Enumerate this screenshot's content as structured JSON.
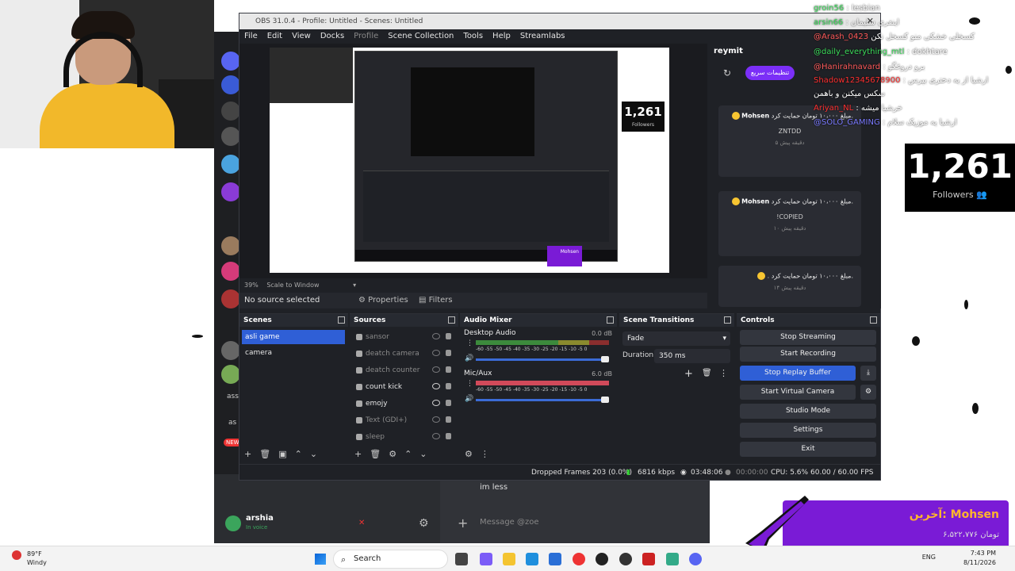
{
  "obs": {
    "title": "OBS 31.0.4 - Profile: Untitled - Scenes: Untitled",
    "menu": [
      "File",
      "Edit",
      "View",
      "Docks",
      "Profile",
      "Scene Collection",
      "Tools",
      "Help",
      "Streamlabs"
    ],
    "scale": {
      "percent": "39%",
      "mode": "Scale to Window"
    },
    "no_source": "No source selected",
    "properties": "Properties",
    "filters": "Filters",
    "scenes": {
      "title": "Scenes",
      "items": [
        "asli game",
        "camera"
      ],
      "selected": 0
    },
    "sources": {
      "title": "Sources",
      "items": [
        {
          "name": "sansor",
          "visible": false
        },
        {
          "name": "deatch camera",
          "visible": false
        },
        {
          "name": "deatch counter",
          "visible": false
        },
        {
          "name": "count kick",
          "visible": true
        },
        {
          "name": "emojy",
          "visible": true
        },
        {
          "name": "Text (GDI+)",
          "visible": false
        },
        {
          "name": "sleep",
          "visible": false
        }
      ]
    },
    "mixer": {
      "title": "Audio Mixer",
      "channels": [
        {
          "name": "Desktop Audio",
          "db": "0.0 dB"
        },
        {
          "name": "Mic/Aux",
          "db": "6.0 dB"
        }
      ],
      "ticks": "-60 -55 -50 -45 -40 -35 -30 -25 -20 -15 -10 -5 0"
    },
    "transitions": {
      "title": "Scene Transitions",
      "type": "Fade",
      "duration_label": "Duration",
      "duration": "350 ms"
    },
    "controls": {
      "title": "Controls",
      "buttons": [
        "Stop Streaming",
        "Start Recording",
        "Stop Replay Buffer",
        "Start Virtual Camera",
        "Studio Mode",
        "Settings",
        "Exit"
      ]
    },
    "status": {
      "dropped": "Dropped Frames 203 (0.0%)",
      "kbps": "6816 kbps",
      "live": "03:48:06",
      "rec": "00:00:00",
      "cpu": "CPU: 5.6%",
      "fps": "60.00 / 60.00 FPS"
    }
  },
  "dock": {
    "title": "reymit",
    "quick": "تنظیمات سریع",
    "messages": [
      {
        "user": "Mohsen",
        "text": "مبلغ ۱۰،۰۰۰ تومان حمایت کرد.",
        "sub": "ZNTDD",
        "time": "۵ دقیقه پیش"
      },
      {
        "user": "Mohsen",
        "text": "مبلغ ۱۰،۰۰۰ تومان حمایت کرد.",
        "sub": "!COPIED",
        "time": "۱۰ دقیقه پیش"
      },
      {
        "user": "",
        "text": ". مبلغ ۱۰،۰۰۰ تومان حمایت کرد.",
        "sub": "",
        "time": "۱۴ دقیقه پیش"
      }
    ]
  },
  "overlay_chat": [
    {
      "user": "groin56",
      "text": ": lesbian"
    },
    {
      "user": "arsin66",
      "text": ": اینفری سلیمان"
    },
    {
      "user": "@Arash_0423",
      "text": "کسخلی خشکی منو کسخل نکن"
    },
    {
      "user": "@daily_everything_mtl",
      "text": ": dokhtare"
    },
    {
      "user": "@Hanirahnavard",
      "text": ": برو دروغگو"
    },
    {
      "user": "Shadow12345678900",
      "text": ": ارشیا از یه دختری بپرس"
    },
    {
      "user": "",
      "text": "سکس میکنن و باهمن"
    },
    {
      "user": "Ariyan_NL",
      "text": ": خرشیا میشه"
    },
    {
      "user": "@SOLO_GAMING",
      "text": ": ارشیا یه موزیک سلام"
    }
  ],
  "followers": {
    "count": "1,261",
    "label": "Followers"
  },
  "donation_banner": {
    "title": "آخرین: Mohsen",
    "amount": "۶،۵۲۲،۷۷۶ تومان"
  },
  "preview": {
    "followers": "1,261",
    "followers_label": "Followers",
    "banner_name": "Mohsen"
  },
  "discord": {
    "user": "arshia",
    "status": "In voice",
    "message": "im less",
    "placeholder": "Message @zoe",
    "new_badge": "NEW",
    "side_labels": [
      "ass",
      "as"
    ]
  },
  "taskbar": {
    "temp": "89°F",
    "weather": "Windy",
    "search": "Search",
    "lang": "ENG",
    "time": "7:43 PM",
    "date": "8/11/2026"
  },
  "colors": {
    "accent": "#2f5fd6",
    "purple": "#7a1bd6",
    "gold": "#ffb52e"
  }
}
